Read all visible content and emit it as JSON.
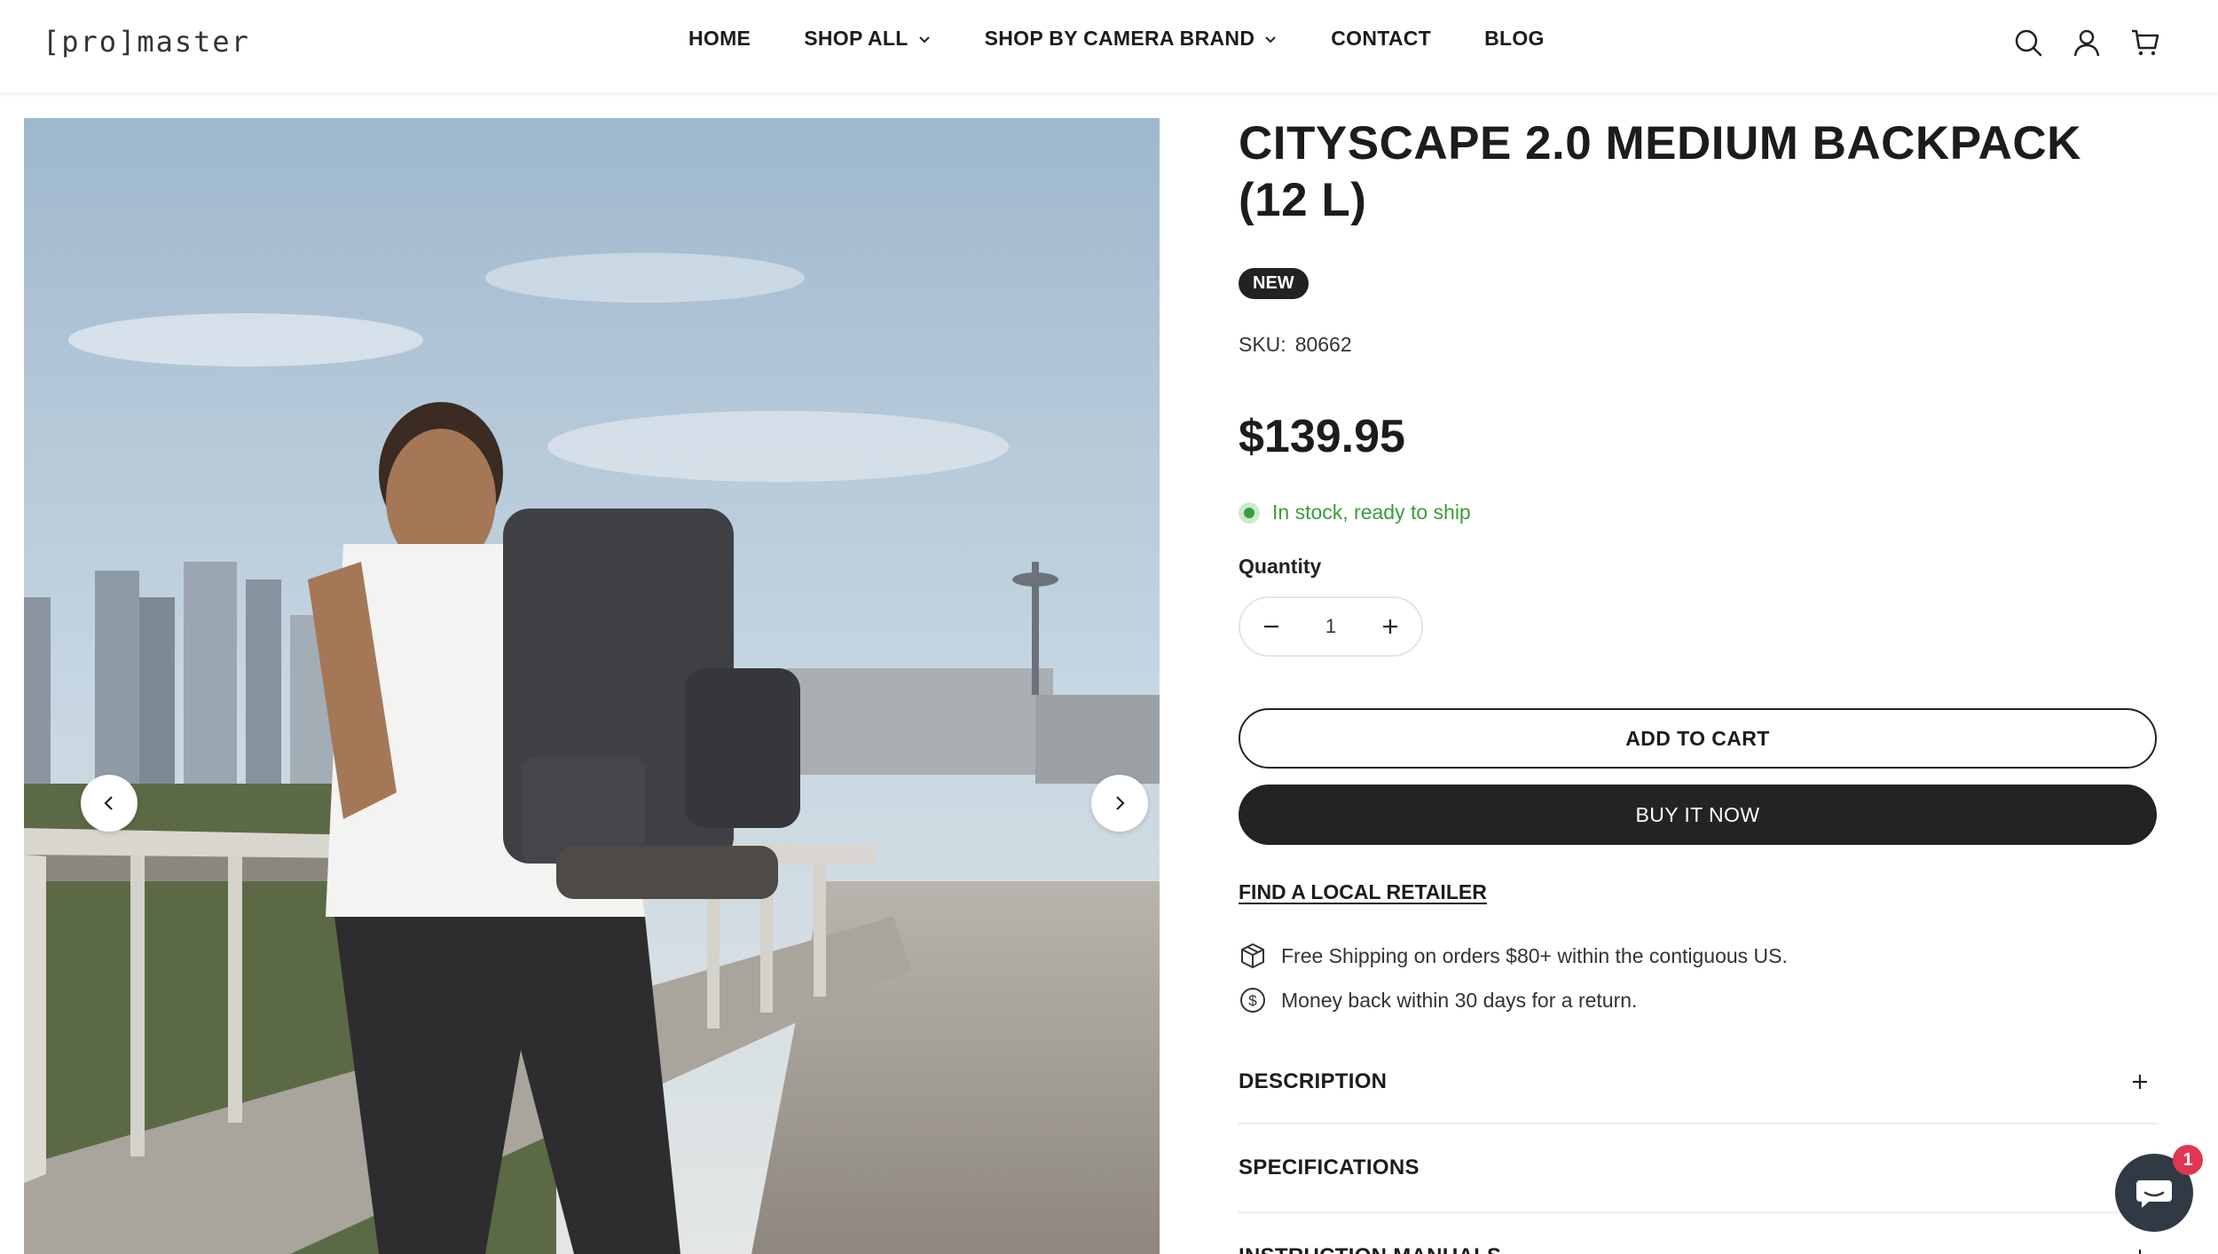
{
  "header": {
    "logo": "[pro]master",
    "nav": [
      {
        "label": "HOME"
      },
      {
        "label": "SHOP ALL",
        "dropdown": true
      },
      {
        "label": "SHOP BY CAMERA BRAND",
        "dropdown": true
      },
      {
        "label": "CONTACT"
      },
      {
        "label": "BLOG"
      }
    ],
    "icons": [
      "search-icon",
      "account-icon",
      "cart-icon"
    ]
  },
  "gallery": {
    "prev_icon": "chevron-left-icon",
    "next_icon": "chevron-right-icon"
  },
  "product": {
    "title": "CITYSCAPE 2.0 MEDIUM BACKPACK (12 L)",
    "badge": "NEW",
    "sku_label": "SKU:",
    "sku_value": "80662",
    "price": "$139.95",
    "stock": "In stock, ready to ship",
    "quantity_label": "Quantity",
    "quantity_value": "1",
    "add_to_cart": "ADD TO CART",
    "buy_now": "BUY IT NOW",
    "retailer_link": "FIND A LOCAL RETAILER",
    "perks": [
      {
        "icon": "box-icon",
        "text": "Free Shipping on orders $80+ within the contiguous US."
      },
      {
        "icon": "dollar-icon",
        "text": "Money back within 30 days for a return."
      }
    ],
    "accordions": [
      {
        "label": "DESCRIPTION"
      },
      {
        "label": "SPECIFICATIONS"
      },
      {
        "label": "INSTRUCTION MANUALS"
      }
    ]
  },
  "chat": {
    "badge_count": "1"
  },
  "colors": {
    "stock_green": "#3a9d3a",
    "dark_button": "#232323",
    "chat_badge": "#e0364f"
  }
}
